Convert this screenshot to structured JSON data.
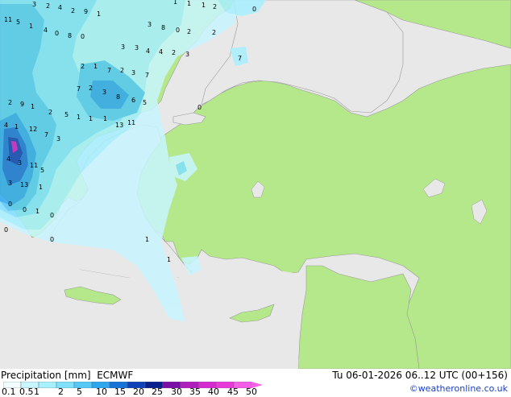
{
  "map": {
    "sea_color": "#e8e8e8",
    "land_in_domain_color": "#b5e88a",
    "land_out_domain_color": "#e8e8e8",
    "precip_palette": [
      "#a7f0ff",
      "#7fe0ff",
      "#55c8f5",
      "#2ea6ee",
      "#1873d9",
      "#0f42b8",
      "#08208e",
      "#c81ec8",
      "#e632d6",
      "#f24ee3"
    ],
    "value_labels": [
      "3",
      "2",
      "4",
      "2",
      "9",
      "1",
      "1",
      "1",
      "1",
      "2",
      "0",
      "11",
      "5",
      "1",
      "4",
      "0",
      "8",
      "0",
      "3",
      "8",
      "0",
      "2",
      "2",
      "3",
      "3",
      "4",
      "4",
      "2",
      "3",
      "7",
      "2",
      "1",
      "7",
      "2",
      "3",
      "7",
      "7",
      "2",
      "3",
      "8",
      "6",
      "5",
      "2",
      "9",
      "1",
      "2",
      "5",
      "1",
      "1",
      "1",
      "13",
      "11",
      "4",
      "1",
      "12",
      "7",
      "3",
      "4",
      "3",
      "11",
      "5",
      "3",
      "13",
      "1",
      "0",
      "0",
      "1",
      "0",
      "0",
      "0",
      "1",
      "1",
      "0"
    ]
  },
  "legend": {
    "title": "Precipitation [mm]",
    "model": "ECMWF",
    "datetime": "Tu 06-01-2026 06..12 UTC (00+156)",
    "credit": "©weatheronline.co.uk",
    "ticks": [
      "0.1",
      "0.5",
      "1",
      "2",
      "5",
      "10",
      "15",
      "20",
      "25",
      "30",
      "35",
      "40",
      "45",
      "50"
    ],
    "colors": [
      "#f0fcff",
      "#c8f5ff",
      "#a7f0ff",
      "#7fe0ff",
      "#55c8f5",
      "#2ea6ee",
      "#1873d9",
      "#0f42b8",
      "#08208e",
      "#7a0fa8",
      "#b01ebe",
      "#d42ad0",
      "#e83ad8",
      "#f55fe6"
    ]
  }
}
